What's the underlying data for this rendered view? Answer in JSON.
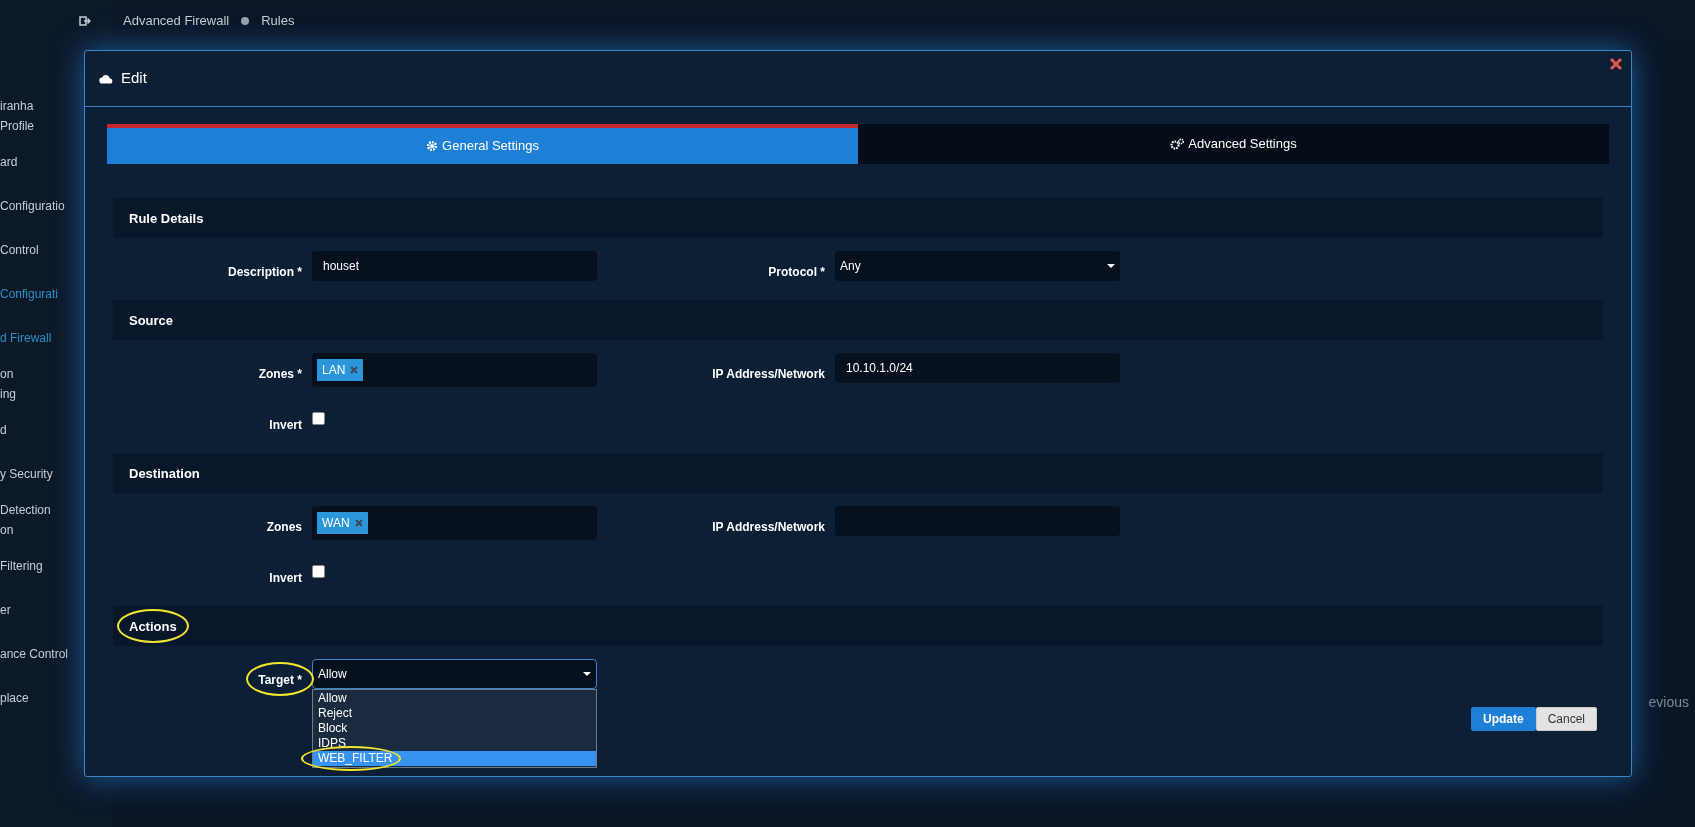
{
  "breadcrumb": [
    {
      "label": "Advanced Firewall"
    },
    {
      "label": "Rules"
    }
  ],
  "sidebar": {
    "items": [
      {
        "lines": [
          "iranha",
          "Profile"
        ],
        "active": false
      },
      {
        "lines": [
          "ard"
        ],
        "active": false
      },
      {
        "lines": [
          "Configuratio"
        ],
        "active": false
      },
      {
        "lines": [
          "Control"
        ],
        "active": false
      },
      {
        "lines": [
          "Configurati"
        ],
        "active": true
      },
      {
        "lines": [
          "d Firewall"
        ],
        "active": true
      },
      {
        "lines": [
          "on",
          "ing"
        ],
        "active": false
      },
      {
        "lines": [
          "d"
        ],
        "active": false
      },
      {
        "lines": [
          "y Security"
        ],
        "active": false
      },
      {
        "lines": [
          "Detection",
          "on"
        ],
        "active": false
      },
      {
        "lines": [
          "Filtering"
        ],
        "active": false
      },
      {
        "lines": [
          "er"
        ],
        "active": false
      },
      {
        "lines": [
          "ance Control"
        ],
        "active": false
      },
      {
        "lines": [
          "place"
        ],
        "active": false
      }
    ]
  },
  "modal": {
    "title": "Edit",
    "tabs": [
      {
        "label": "General Settings",
        "selected": true
      },
      {
        "label": "Advanced Settings",
        "selected": false
      }
    ],
    "sections": [
      {
        "title": "Rule Details",
        "circled": false,
        "rows": [
          [
            {
              "kind": "text",
              "label": "Description *",
              "value": "houset",
              "circled": false
            },
            {
              "kind": "select",
              "label": "Protocol *",
              "value": "Any",
              "circled": false
            }
          ]
        ]
      },
      {
        "title": "Source",
        "circled": false,
        "rows": [
          [
            {
              "kind": "tags",
              "label": "Zones *",
              "tags": [
                "LAN"
              ],
              "circled": false
            },
            {
              "kind": "text",
              "label": "IP Address/Network",
              "value": "10.10.1.0/24",
              "circled": false
            }
          ],
          [
            {
              "kind": "checkbox",
              "label": "Invert",
              "checked": false,
              "circled": false
            }
          ]
        ]
      },
      {
        "title": "Destination",
        "circled": false,
        "rows": [
          [
            {
              "kind": "tags",
              "label": "Zones",
              "tags": [
                "WAN"
              ],
              "circled": false
            },
            {
              "kind": "text",
              "label": "IP Address/Network",
              "circled": false
            }
          ],
          [
            {
              "kind": "checkbox",
              "label": "Invert",
              "checked": false,
              "circled": false
            }
          ]
        ]
      },
      {
        "title": "Actions",
        "circled": true,
        "rows": [
          [
            {
              "kind": "select",
              "label": "Target *",
              "value": "Allow",
              "circled": true,
              "expanded": true,
              "options": [
                {
                  "label": "Allow",
                  "highlighted": false,
                  "circled": false
                },
                {
                  "label": "Reject",
                  "highlighted": false,
                  "circled": false
                },
                {
                  "label": "Block",
                  "highlighted": false,
                  "circled": false
                },
                {
                  "label": "IDPS",
                  "highlighted": false,
                  "circled": false
                },
                {
                  "label": "WEB_FILTER",
                  "highlighted": true,
                  "circled": true
                }
              ]
            }
          ]
        ]
      }
    ],
    "buttons": [
      {
        "label": "Update",
        "kind": "primary"
      },
      {
        "label": "Cancel",
        "kind": "secondary"
      }
    ]
  },
  "pagination": {
    "previous": "evious"
  }
}
